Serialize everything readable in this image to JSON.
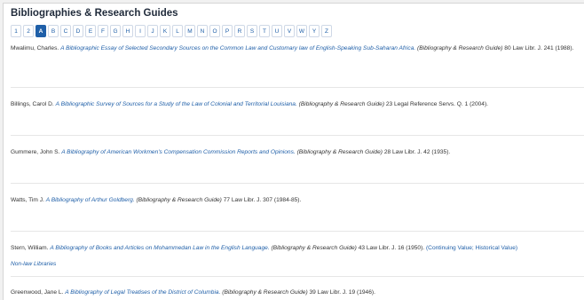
{
  "header": {
    "title": "Bibliographies & Research Guides"
  },
  "alphabet": [
    "1",
    "2",
    "A",
    "B",
    "C",
    "D",
    "E",
    "F",
    "G",
    "H",
    "I",
    "J",
    "K",
    "L",
    "M",
    "N",
    "O",
    "P",
    "R",
    "S",
    "T",
    "U",
    "V",
    "W",
    "Y",
    "Z"
  ],
  "active_letter": "A",
  "entries": [
    {
      "author": "Mwalimu, Charles.",
      "title": "A Bibliographic Essay of Selected Secondary Sources on the Common Law and Customary law of English-Speaking Sub-Saharan Africa.",
      "guide": "(Bibliography & Research Guide)",
      "cite": "80 Law Libr. J. 241 (1988)."
    },
    {
      "author": "Billings, Carol D.",
      "title": "A Bibliographic Survey of Sources for a Study of the Law of Colonial and Territorial Louisiana.",
      "guide": "(Bibliography & Research Guide)",
      "cite": "23 Legal Reference Servs. Q. 1 (2004)."
    },
    {
      "author": "Gummere, John S.",
      "title": "A Bibliography of American Workmen's Compensation Commission Reports and Opinions.",
      "guide": "(Bibliography & Research Guide)",
      "cite": "28 Law Libr. J. 42 (1935)."
    },
    {
      "author": "Watts, Tim J.",
      "title": "A Bibliography of Arthur Goldberg.",
      "guide": "(Bibliography & Research Guide)",
      "cite": "77 Law Libr. J. 307 (1984-85)."
    },
    {
      "author": "Stern, William.",
      "title": "A Bibliography of Books and Articles on Mohammedan Law in the English Language.",
      "guide": "(Bibliography & Research Guide)",
      "cite": "43 Law Libr. J. 16 (1950).",
      "links": "(Continuing Value; Historical Value)",
      "sub": "Non-law Libraries"
    },
    {
      "author": "Greenwood, Jane L.",
      "title": "A Bibliography of Legal Treatises of the District of Columbia.",
      "guide": "(Bibliography & Research Guide)",
      "cite": "39 Law Libr. J. 19 (1946)."
    }
  ]
}
